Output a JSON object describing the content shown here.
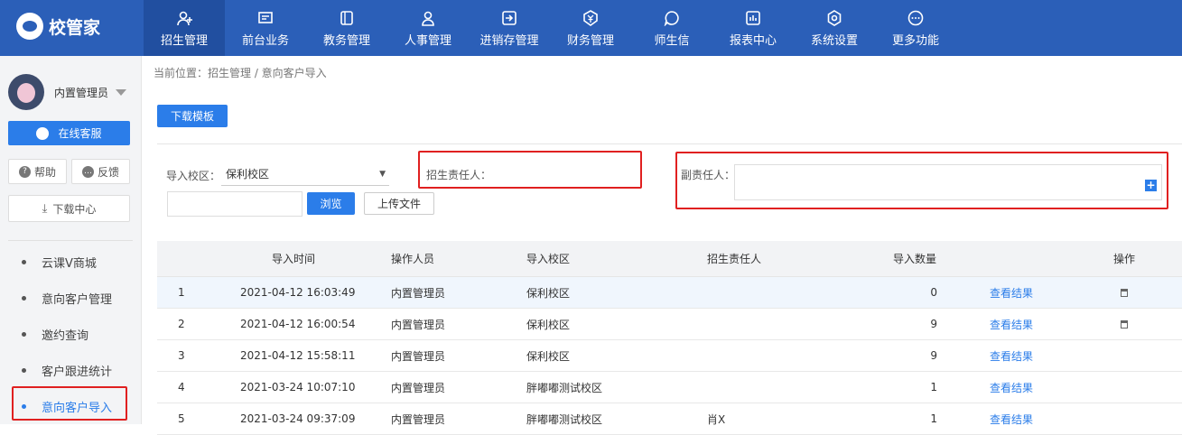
{
  "app": {
    "logo_text": "校管家"
  },
  "nav": {
    "items": [
      {
        "label": "招生管理",
        "icon": "user-plus-icon"
      },
      {
        "label": "前台业务",
        "icon": "monitor-icon"
      },
      {
        "label": "教务管理",
        "icon": "book-icon"
      },
      {
        "label": "人事管理",
        "icon": "person-icon"
      },
      {
        "label": "进销存管理",
        "icon": "enter-box-icon"
      },
      {
        "label": "财务管理",
        "icon": "yuan-shield-icon"
      },
      {
        "label": "师生信",
        "icon": "chat-circle-icon"
      },
      {
        "label": "报表中心",
        "icon": "chart-icon"
      },
      {
        "label": "系统设置",
        "icon": "gear-icon"
      },
      {
        "label": "更多功能",
        "icon": "more-icon"
      }
    ],
    "active_index": 0
  },
  "sidebar": {
    "user_name": "内置管理员",
    "online_service": "在线客服",
    "help": "帮助",
    "feedback": "反馈",
    "download_center": "下载中心",
    "menu": [
      "云课V商城",
      "意向客户管理",
      "邀约查询",
      "客户跟进统计",
      "意向客户导入"
    ],
    "active_menu_index": 4
  },
  "breadcrumb": "当前位置：招生管理 / 意向客户导入",
  "toolbar": {
    "download_template": "下载模板"
  },
  "form": {
    "campus_label": "导入校区：",
    "campus_value": "保利校区",
    "browse": "浏览",
    "upload": "上传文件",
    "owner_label": "招生责任人：",
    "deputy_label": "副责任人："
  },
  "table": {
    "headers": [
      "导入时间",
      "操作人员",
      "导入校区",
      "招生责任人",
      "导入数量",
      "操作"
    ],
    "rows": [
      {
        "no": "1",
        "time": "2021-04-12 16:03:49",
        "operator": "内置管理员",
        "campus": "保利校区",
        "owner": "",
        "count": "0",
        "action": "查看结果",
        "deletable": true
      },
      {
        "no": "2",
        "time": "2021-04-12 16:00:54",
        "operator": "内置管理员",
        "campus": "保利校区",
        "owner": "",
        "count": "9",
        "action": "查看结果",
        "deletable": true
      },
      {
        "no": "3",
        "time": "2021-04-12 15:58:11",
        "operator": "内置管理员",
        "campus": "保利校区",
        "owner": "",
        "count": "9",
        "action": "查看结果",
        "deletable": false
      },
      {
        "no": "4",
        "time": "2021-03-24 10:07:10",
        "operator": "内置管理员",
        "campus": "胖嘟嘟测试校区",
        "owner": "",
        "count": "1",
        "action": "查看结果",
        "deletable": false
      },
      {
        "no": "5",
        "time": "2021-03-24 09:37:09",
        "operator": "内置管理员",
        "campus": "胖嘟嘟测试校区",
        "owner": "肖X",
        "count": "1",
        "action": "查看结果",
        "deletable": false
      }
    ]
  },
  "colors": {
    "brand": "#2b5fb8",
    "accent": "#2b7de9",
    "highlight": "#e02020"
  }
}
